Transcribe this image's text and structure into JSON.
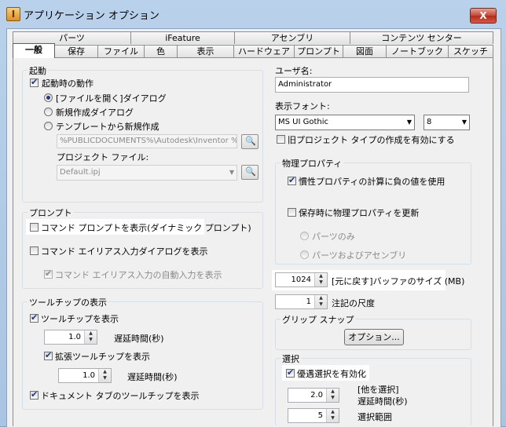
{
  "window": {
    "title": "アプリケーション オプション",
    "close": "X"
  },
  "tabs_back": [
    "パーツ",
    "iFeature",
    "アセンブリ",
    "コンテンツ センター"
  ],
  "tabs_front": [
    "一般",
    "保存",
    "ファイル",
    "色",
    "表示",
    "ハードウェア",
    "プロンプト",
    "図面",
    "ノートブック",
    "スケッチ"
  ],
  "startup": {
    "group": "起動",
    "action_label": "起動時の動作",
    "action_checked": true,
    "radio_open": "[ファイルを開く]ダイアログ",
    "radio_new": "新規作成ダイアログ",
    "radio_template": "テンプレートから新規作成",
    "selected_radio": "open",
    "template_path": "%PUBLICDOCUMENTS%\\Autodesk\\Inventor %F",
    "project_label": "プロジェクト ファイル:",
    "project_value": "Default.ipj"
  },
  "prompt": {
    "group": "プロンプト",
    "show_command_prompt": "コマンド プロンプトを表示(ダイナミック プロンプト)",
    "show_command_prompt_checked": false,
    "command_alias_dialog": "コマンド エイリアス入力ダイアログを表示",
    "command_alias_dialog_checked": false,
    "auto_complete": "コマンド エイリアス入力の自動入力を表示",
    "auto_complete_checked": true
  },
  "tooltip": {
    "group": "ツールチップの表示",
    "show_tooltips": "ツールチップを表示",
    "show_tooltips_checked": true,
    "delay1_value": "1.0",
    "delay1_label": "遅延時間(秒)",
    "extended": "拡張ツールチップを表示",
    "extended_checked": true,
    "delay2_value": "1.0",
    "delay2_label": "遅延時間(秒)",
    "doc_tab": "ドキュメント タブのツールチップを表示",
    "doc_tab_checked": true
  },
  "user": {
    "name_label": "ユーザ名:",
    "name_value": "Administrator",
    "font_label": "表示フォント:",
    "font_value": "MS UI Gothic",
    "font_size": "8",
    "legacy_project": "旧プロジェクト タイプの作成を有効にする",
    "legacy_project_checked": false
  },
  "physical": {
    "group": "物理プロパティ",
    "inertia": "慣性プロパティの計算に負の値を使用",
    "inertia_checked": true,
    "update_on_save": "保存時に物理プロパティを更新",
    "update_on_save_checked": false,
    "parts_only": "パーツのみ",
    "parts_and_assemblies": "パーツおよびアセンブリ"
  },
  "undo": {
    "value": "1024",
    "label": "[元に戻す]バッファのサイズ (MB)"
  },
  "annotation": {
    "value": "1",
    "label": "注記の尺度"
  },
  "grip": {
    "group": "グリップ スナップ",
    "options_button": "オプション..."
  },
  "selection": {
    "group": "選択",
    "prioritized": "優遇選択を有効化",
    "prioritized_checked": true,
    "other_select_label": "[他を選択]",
    "delay_value": "2.0",
    "delay_label": "遅延時間(秒)",
    "range_value": "5",
    "range_label": "選択範囲"
  }
}
